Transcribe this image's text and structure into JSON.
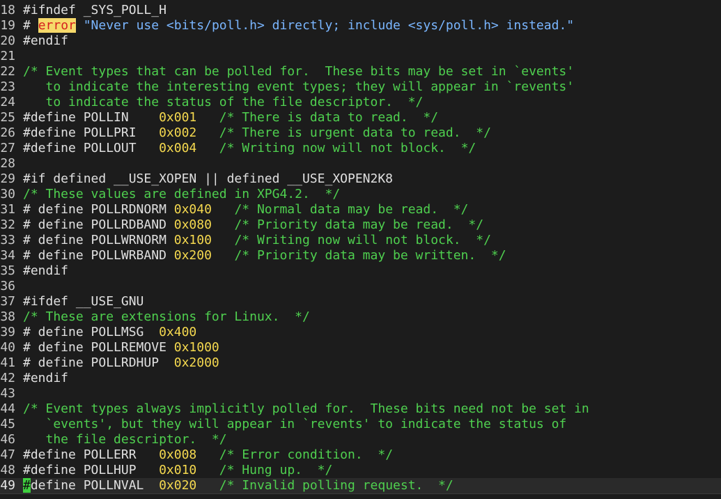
{
  "editor": {
    "lines": [
      {
        "num": "18",
        "segments": [
          {
            "t": "#ifndef _SYS_POLL_H",
            "c": "pre"
          }
        ]
      },
      {
        "num": "19",
        "segments": [
          {
            "t": "# ",
            "c": "pre"
          },
          {
            "t": "error",
            "c": "err"
          },
          {
            "t": " \"Never use <bits/poll.h> directly; include <sys/poll.h> instead.\"",
            "c": "str"
          }
        ]
      },
      {
        "num": "20",
        "segments": [
          {
            "t": "#endif",
            "c": "pre"
          }
        ]
      },
      {
        "num": "21",
        "segments": []
      },
      {
        "num": "22",
        "segments": [
          {
            "t": "/* Event types that can be polled for.  These bits may be set in `events'",
            "c": "cm"
          }
        ]
      },
      {
        "num": "23",
        "segments": [
          {
            "t": "   to indicate the interesting event types; they will appear in `revents'",
            "c": "cm"
          }
        ]
      },
      {
        "num": "24",
        "segments": [
          {
            "t": "   to indicate the status of the file descriptor.  */",
            "c": "cm"
          }
        ]
      },
      {
        "num": "25",
        "segments": [
          {
            "t": "#define POLLIN    ",
            "c": "pre"
          },
          {
            "t": "0x001",
            "c": "num"
          },
          {
            "t": "   ",
            "c": "pre"
          },
          {
            "t": "/* There is data to read.  */",
            "c": "cm"
          }
        ]
      },
      {
        "num": "26",
        "segments": [
          {
            "t": "#define POLLPRI   ",
            "c": "pre"
          },
          {
            "t": "0x002",
            "c": "num"
          },
          {
            "t": "   ",
            "c": "pre"
          },
          {
            "t": "/* There is urgent data to read.  */",
            "c": "cm"
          }
        ]
      },
      {
        "num": "27",
        "segments": [
          {
            "t": "#define POLLOUT   ",
            "c": "pre"
          },
          {
            "t": "0x004",
            "c": "num"
          },
          {
            "t": "   ",
            "c": "pre"
          },
          {
            "t": "/* Writing now will not block.  */",
            "c": "cm"
          }
        ]
      },
      {
        "num": "28",
        "segments": []
      },
      {
        "num": "29",
        "segments": [
          {
            "t": "#if defined __USE_XOPEN || defined __USE_XOPEN2K8",
            "c": "pre"
          }
        ]
      },
      {
        "num": "30",
        "segments": [
          {
            "t": "/* These values are defined in XPG4.2.  */",
            "c": "cm"
          }
        ]
      },
      {
        "num": "31",
        "segments": [
          {
            "t": "# define POLLRDNORM ",
            "c": "pre"
          },
          {
            "t": "0x040",
            "c": "num"
          },
          {
            "t": "   ",
            "c": "pre"
          },
          {
            "t": "/* Normal data may be read.  */",
            "c": "cm"
          }
        ]
      },
      {
        "num": "32",
        "segments": [
          {
            "t": "# define POLLRDBAND ",
            "c": "pre"
          },
          {
            "t": "0x080",
            "c": "num"
          },
          {
            "t": "   ",
            "c": "pre"
          },
          {
            "t": "/* Priority data may be read.  */",
            "c": "cm"
          }
        ]
      },
      {
        "num": "33",
        "segments": [
          {
            "t": "# define POLLWRNORM ",
            "c": "pre"
          },
          {
            "t": "0x100",
            "c": "num"
          },
          {
            "t": "   ",
            "c": "pre"
          },
          {
            "t": "/* Writing now will not block.  */",
            "c": "cm"
          }
        ]
      },
      {
        "num": "34",
        "segments": [
          {
            "t": "# define POLLWRBAND ",
            "c": "pre"
          },
          {
            "t": "0x200",
            "c": "num"
          },
          {
            "t": "   ",
            "c": "pre"
          },
          {
            "t": "/* Priority data may be written.  */",
            "c": "cm"
          }
        ]
      },
      {
        "num": "35",
        "segments": [
          {
            "t": "#endif",
            "c": "pre"
          }
        ]
      },
      {
        "num": "36",
        "segments": []
      },
      {
        "num": "37",
        "segments": [
          {
            "t": "#ifdef __USE_GNU",
            "c": "pre"
          }
        ]
      },
      {
        "num": "38",
        "segments": [
          {
            "t": "/* These are extensions for Linux.  */",
            "c": "cm"
          }
        ]
      },
      {
        "num": "39",
        "segments": [
          {
            "t": "# define POLLMSG  ",
            "c": "pre"
          },
          {
            "t": "0x400",
            "c": "num"
          }
        ]
      },
      {
        "num": "40",
        "segments": [
          {
            "t": "# define POLLREMOVE ",
            "c": "pre"
          },
          {
            "t": "0x1000",
            "c": "num"
          }
        ]
      },
      {
        "num": "41",
        "segments": [
          {
            "t": "# define POLLRDHUP  ",
            "c": "pre"
          },
          {
            "t": "0x2000",
            "c": "num"
          }
        ]
      },
      {
        "num": "42",
        "segments": [
          {
            "t": "#endif",
            "c": "pre"
          }
        ]
      },
      {
        "num": "43",
        "segments": []
      },
      {
        "num": "44",
        "segments": [
          {
            "t": "/* Event types always implicitly polled for.  These bits need not be set in",
            "c": "cm"
          }
        ]
      },
      {
        "num": "45",
        "segments": [
          {
            "t": "   `events', but they will appear in `revents' to indicate the status of",
            "c": "cm"
          }
        ]
      },
      {
        "num": "46",
        "segments": [
          {
            "t": "   the file descriptor.  */",
            "c": "cm"
          }
        ]
      },
      {
        "num": "47",
        "segments": [
          {
            "t": "#define POLLERR   ",
            "c": "pre"
          },
          {
            "t": "0x008",
            "c": "num"
          },
          {
            "t": "   ",
            "c": "pre"
          },
          {
            "t": "/* Error condition.  */",
            "c": "cm"
          }
        ]
      },
      {
        "num": "48",
        "segments": [
          {
            "t": "#define POLLHUP   ",
            "c": "pre"
          },
          {
            "t": "0x010",
            "c": "num"
          },
          {
            "t": "   ",
            "c": "pre"
          },
          {
            "t": "/* Hung up.  */",
            "c": "cm"
          }
        ]
      },
      {
        "num": "49",
        "current": true,
        "segments": [
          {
            "t": "#",
            "c": "cursor"
          },
          {
            "t": "define POLLNVAL  ",
            "c": "pre"
          },
          {
            "t": "0x020",
            "c": "num"
          },
          {
            "t": "   ",
            "c": "pre"
          },
          {
            "t": "/* Invalid polling request.  */",
            "c": "cm"
          }
        ]
      }
    ]
  },
  "colors": {
    "background": "#1c1c1c",
    "comment": "#4fd04f",
    "number": "#f5d94f",
    "string": "#7ab6ff",
    "error_bg": "#f6d96a",
    "error_fg": "#d51f1f",
    "cursor": "#3fcf3f"
  }
}
